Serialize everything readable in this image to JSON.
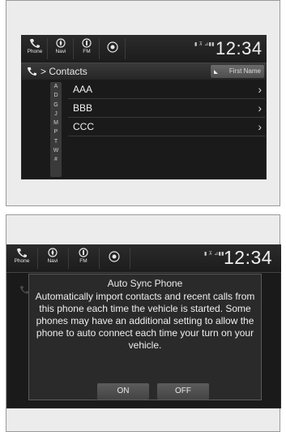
{
  "screen1": {
    "nav": {
      "phone_label": "Phone",
      "navi_label": "Navi",
      "fm_label": "FM"
    },
    "status_icons": "▮ ⊼ ⊿▮▮",
    "clock": "12:34",
    "breadcrumb": "> Contacts",
    "sort_button": "First Name",
    "index_letters": [
      "A",
      "D",
      "G",
      "J",
      "M",
      "P",
      "T",
      "W",
      "#"
    ],
    "contacts": [
      {
        "name": "AAA"
      },
      {
        "name": "BBB"
      },
      {
        "name": "CCC"
      }
    ]
  },
  "screen2": {
    "nav": {
      "phone_label": "Phone",
      "navi_label": "Navi",
      "fm_label": "FM"
    },
    "status_icons": "▮ ⊼ ⊿▮▮",
    "clock": "12:34",
    "dialog": {
      "title": "Auto Sync Phone",
      "message": "Automatically import contacts and recent calls from this phone each time the vehicle is started. Some phones may have an additional setting to allow the phone to auto connect each time your turn on your vehicle.",
      "on_label": "ON",
      "off_label": "OFF"
    }
  }
}
